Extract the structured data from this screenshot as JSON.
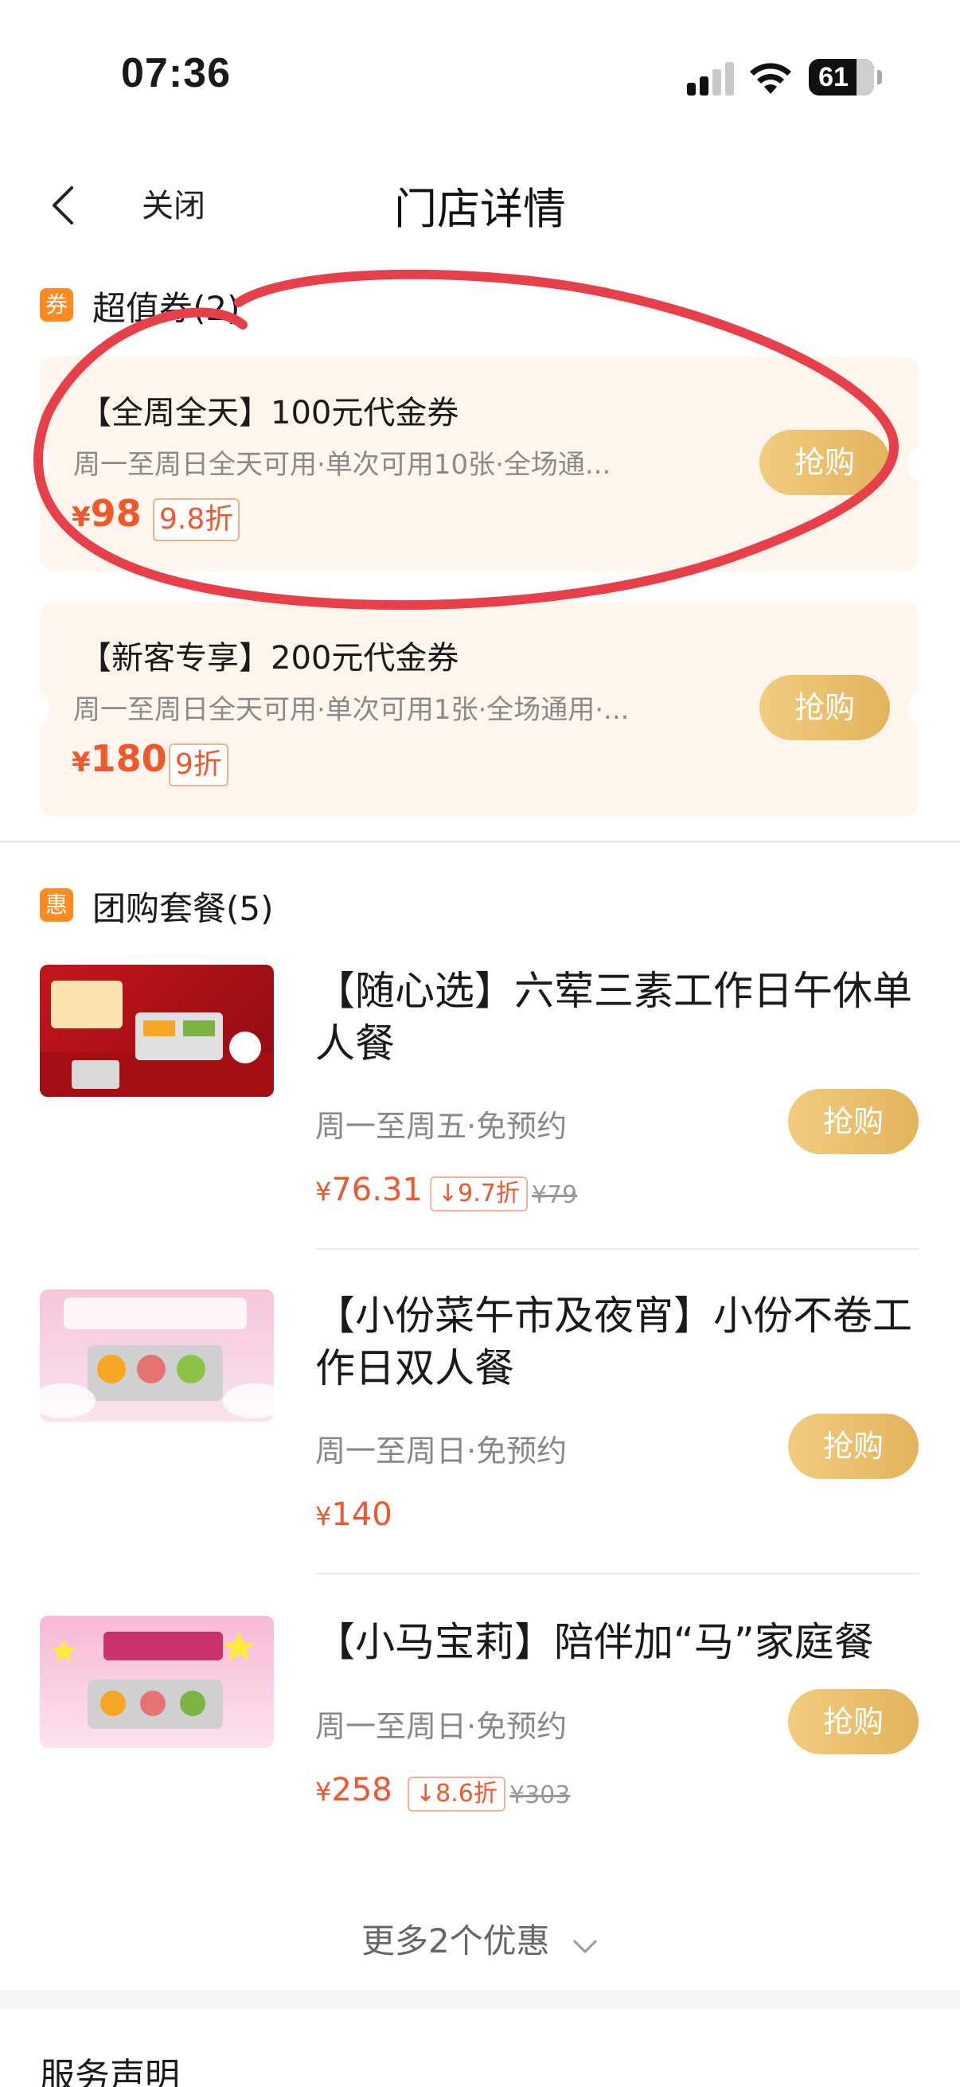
{
  "status_bar": {
    "time": "07:36",
    "battery": "61"
  },
  "nav": {
    "close_label": "关闭",
    "title": "门店详情"
  },
  "vouchers_section": {
    "badge": "券",
    "title": "超值券(2)"
  },
  "vouchers": [
    {
      "title": "【全周全天】100元代金券",
      "desc": "周一至周日全天可用·单次可用10张·全场通...",
      "price": "98",
      "discount": "9.8折",
      "button": "抢购"
    },
    {
      "title": "【新客专享】200元代金券",
      "desc": "周一至周日全天可用·单次可用1张·全场通用·...",
      "price": "180",
      "discount": "9折",
      "button": "抢购"
    }
  ],
  "deals_section": {
    "badge": "惠",
    "title": "团购套餐(5)"
  },
  "deals": [
    {
      "title": "【随心选】六荤三素工作日午休单人餐",
      "sub": "周一至周五·免预约",
      "price": "76.31",
      "tag": "9.7折",
      "original": "¥79",
      "button": "抢购"
    },
    {
      "title": "【小份菜午市及夜宵】小份不卷工作日双人餐",
      "sub": "周一至周日·免预约",
      "price": "140",
      "tag": "",
      "original": "",
      "button": "抢购"
    },
    {
      "title": "【小马宝莉】陪伴加“马”家庭餐",
      "sub": "周一至周日·免预约",
      "price": "258",
      "tag": "8.6折",
      "original": "¥303",
      "button": "抢购"
    }
  ],
  "more": {
    "label": "更多2个优惠"
  },
  "footer": {
    "title": "服务声明"
  },
  "currency": "¥",
  "colors": {
    "accent": "#f0572c",
    "button": "#e8bf6b",
    "card_bg": "#fff5ec",
    "annotation": "#e8404a"
  }
}
